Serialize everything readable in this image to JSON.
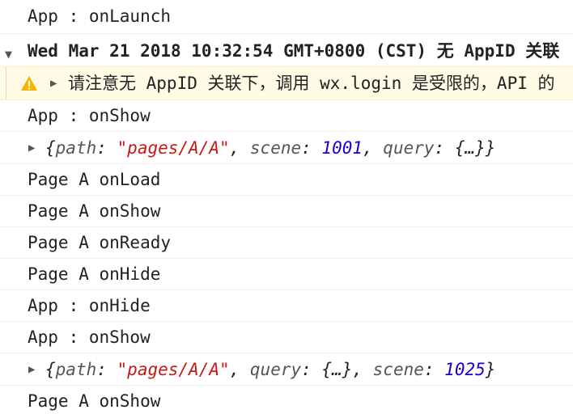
{
  "rows": {
    "r0": "App : onLaunch",
    "group_header": "Wed Mar 21 2018 10:32:54 GMT+0800 (CST) 无 AppID 关联",
    "warning": "请注意无 AppID 关联下，调用 wx.login 是受限的，API 的",
    "r3": "App : onShow",
    "obj1": {
      "open": "{",
      "k1": "path",
      "colon": ": ",
      "v1": "\"pages/A/A\"",
      "sep": ", ",
      "k2": "scene",
      "v2": "1001",
      "k3": "query",
      "v3": "{…}",
      "close": "}"
    },
    "r5": "Page A onLoad",
    "r6": "Page A onShow",
    "r7": "Page A onReady",
    "r8": "Page A onHide",
    "r9": "App : onHide",
    "r10": "App : onShow",
    "obj2": {
      "open": "{",
      "k1": "path",
      "colon": ": ",
      "v1": "\"pages/A/A\"",
      "sep": ", ",
      "k2": "query",
      "v2": "{…}",
      "k3": "scene",
      "v3": "1025",
      "close": "}"
    },
    "r12": "Page A onShow"
  },
  "icons": {
    "group_toggle": "triangle-down-icon",
    "warning": "warning-icon",
    "expand": "triangle-right-icon"
  },
  "colors": {
    "string": "#c41a16",
    "number": "#1c00cf",
    "warning_bg": "#fffbe6",
    "warning_icon": "#f4b400"
  }
}
